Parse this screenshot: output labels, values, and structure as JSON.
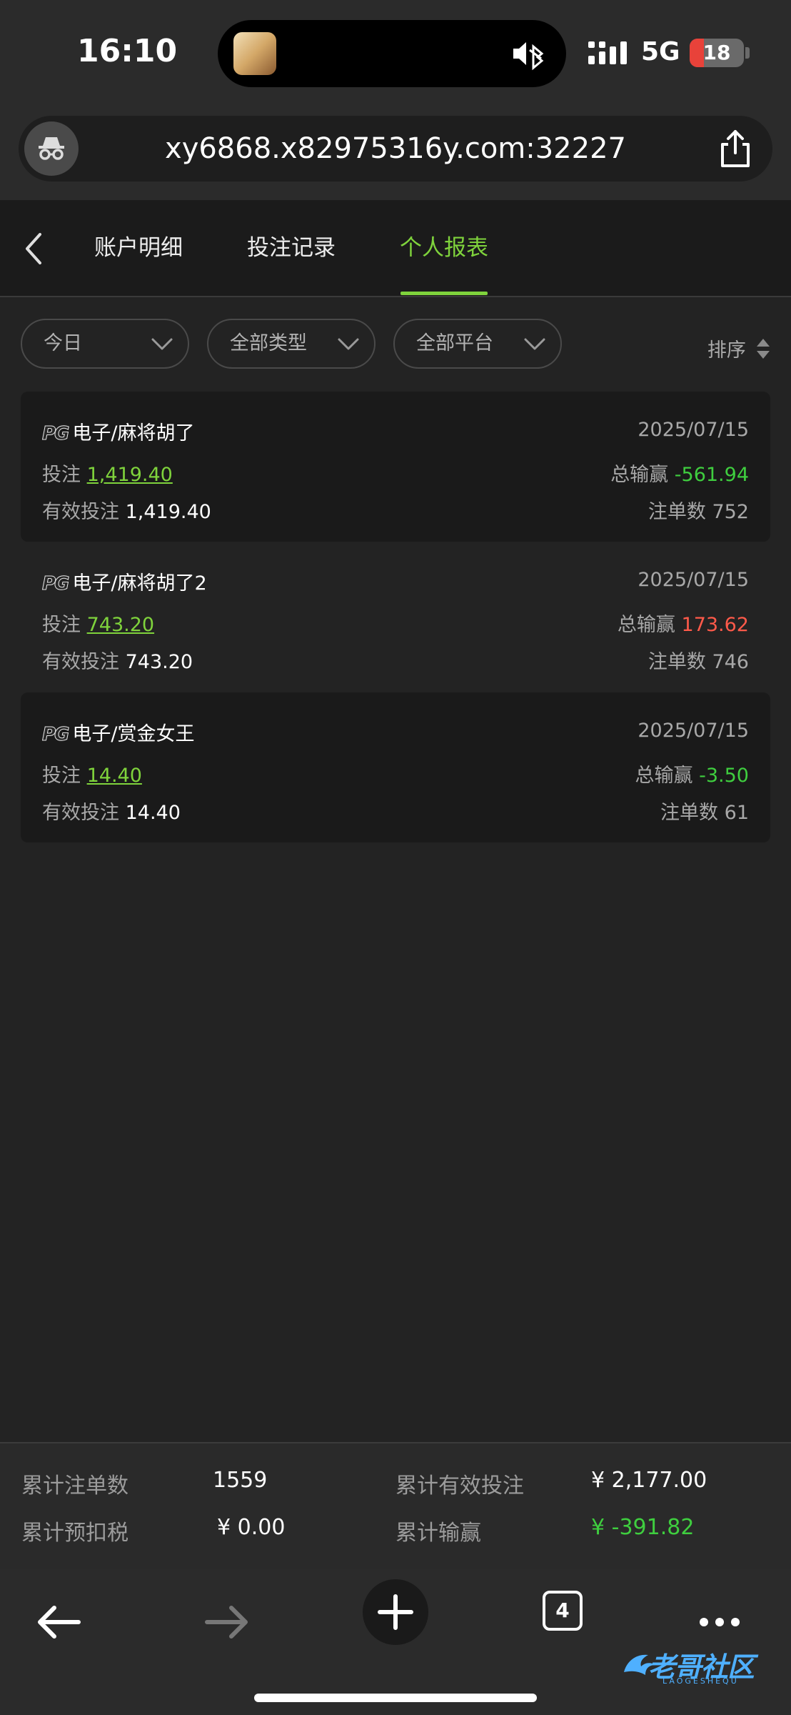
{
  "status": {
    "time": "16:10",
    "network": "5G",
    "battery": "18",
    "battery_level": 0.18
  },
  "browser": {
    "url": "xy6868.x82975316y.com:32227"
  },
  "tabs": [
    {
      "label": "账户明细",
      "active": false
    },
    {
      "label": "投注记录",
      "active": false
    },
    {
      "label": "个人报表",
      "active": true
    }
  ],
  "filters": {
    "date": "今日",
    "type": "全部类型",
    "platform": "全部平台",
    "sort": "排序"
  },
  "records": [
    {
      "logo": "PG",
      "game": "电子/麻将胡了",
      "date": "2025/07/15",
      "bet_label": "投注",
      "bet": "1,419.40",
      "winloss_label": "总输赢",
      "winloss": "-561.94",
      "valid_label": "有效投注",
      "valid": "1,419.40",
      "count_label": "注单数",
      "count": "752"
    },
    {
      "logo": "PG",
      "game": "电子/麻将胡了2",
      "date": "2025/07/15",
      "bet_label": "投注",
      "bet": "743.20",
      "winloss_label": "总输赢",
      "winloss": "173.62",
      "valid_label": "有效投注",
      "valid": "743.20",
      "count_label": "注单数",
      "count": "746"
    },
    {
      "logo": "PG",
      "game": "电子/赏金女王",
      "date": "2025/07/15",
      "bet_label": "投注",
      "bet": "14.40",
      "winloss_label": "总输赢",
      "winloss": "-3.50",
      "valid_label": "有效投注",
      "valid": "14.40",
      "count_label": "注单数",
      "count": "61"
    }
  ],
  "summary": {
    "total_bets_label": "累计注单数",
    "total_bets": "1559",
    "total_valid_label": "累计有效投注",
    "total_valid": "¥ 2,177.00",
    "tax_label": "累计预扣税",
    "tax": "¥ 0.00",
    "winloss_label": "累计输赢",
    "winloss": "¥ -391.82"
  },
  "bottom": {
    "tab_count": "4"
  },
  "watermark": {
    "text": "老哥社区",
    "sub": "LAOGESHEQU"
  },
  "colors": {
    "accent": "#7fd33c",
    "win": "#ff5a4a",
    "loss": "#3fce3f",
    "bg": "#232323"
  }
}
